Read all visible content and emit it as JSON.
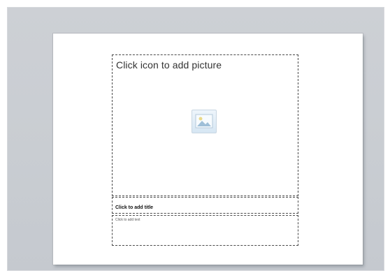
{
  "slide": {
    "picture_placeholder": {
      "prompt": "Click icon to add picture",
      "icon": "insert-picture-icon"
    },
    "title_placeholder": {
      "prompt": "Click to add title"
    },
    "text_placeholder": {
      "prompt": "Click to add text"
    }
  },
  "colors": {
    "workspace": "#c9cdd2",
    "slide": "#ffffff",
    "placeholder_border": "#4a4a4a",
    "icon_fill": "#d6e6f3"
  }
}
